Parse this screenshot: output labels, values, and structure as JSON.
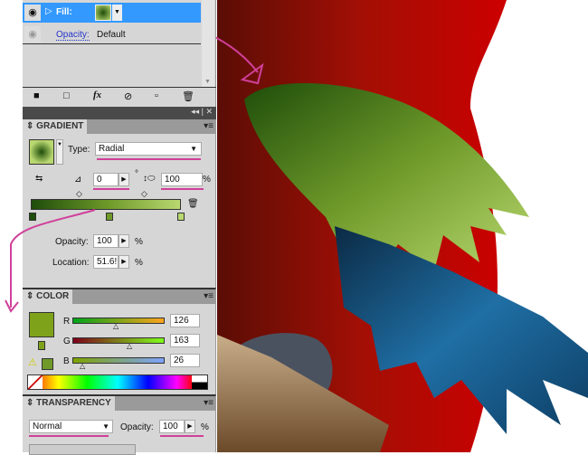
{
  "appearance": {
    "fill_label": "Fill:",
    "opacity_label": "Opacity:",
    "opacity_value": "Default"
  },
  "gradient": {
    "title": "GRADIENT",
    "type_label": "Type:",
    "type_value": "Radial",
    "angle": "0",
    "angle_unit": "°",
    "aspect": "100",
    "aspect_unit": "%",
    "opacity_label": "Opacity:",
    "opacity_value": "100",
    "opacity_unit": "%",
    "location_label": "Location:",
    "location_value": "51.6!",
    "location_unit": "%",
    "stops": [
      "#1e4d0a",
      "#6f9a2a",
      "#b9d870"
    ]
  },
  "color": {
    "title": "COLOR",
    "r_label": "R",
    "g_label": "G",
    "b_label": "B",
    "r": "126",
    "g": "163",
    "b": "26",
    "swatch": "#7ea31a",
    "r_fraction": 0.49,
    "g_fraction": 0.64,
    "b_fraction": 0.1
  },
  "transparency": {
    "title": "TRANSPARENCY",
    "blend_mode": "Normal",
    "opacity_label": "Opacity:",
    "opacity_value": "100",
    "opacity_unit": "%"
  },
  "colors": {
    "selection": "#3399ff",
    "annotation": "#d0409a"
  }
}
